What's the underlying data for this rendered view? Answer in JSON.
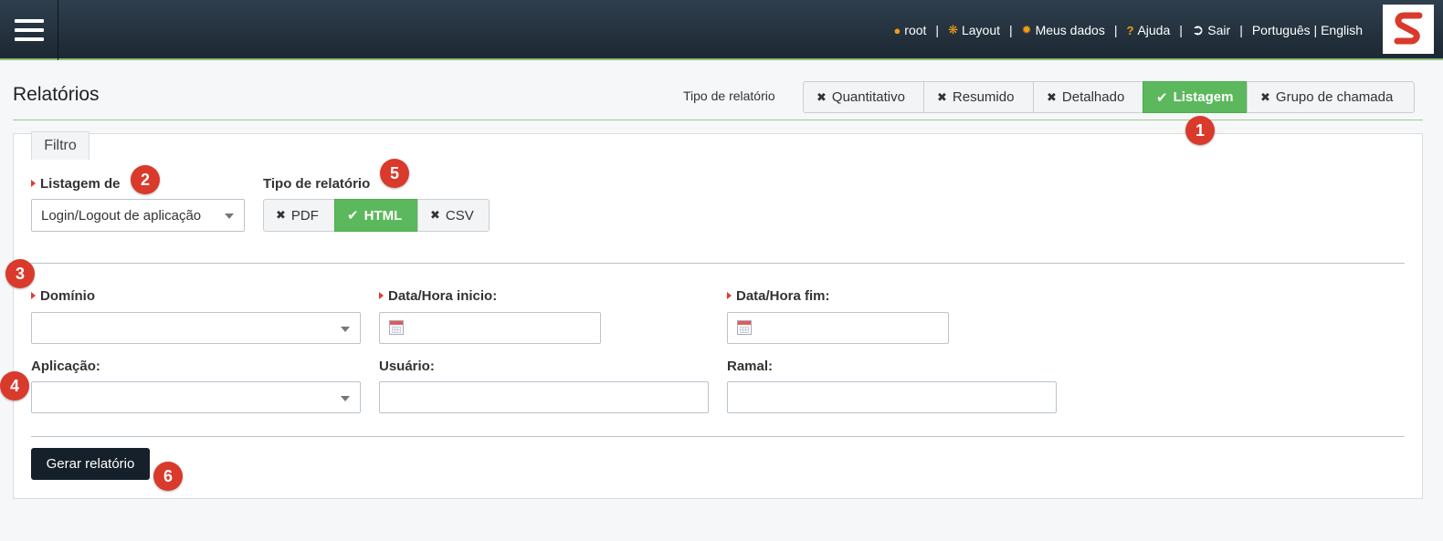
{
  "topbar": {
    "nav": [
      {
        "icon": "user-icon",
        "label": "root"
      },
      {
        "icon": "cogs-icon",
        "label": "Layout"
      },
      {
        "icon": "gear-icon",
        "label": "Meus dados"
      },
      {
        "icon": "help-icon",
        "label": "Ajuda"
      },
      {
        "icon": "sign-out-icon",
        "label": "Sair"
      }
    ],
    "languages": "Português | English",
    "separator": "|"
  },
  "page": {
    "title": "Relatórios",
    "report_type_label": "Tipo de relatório",
    "report_types": [
      {
        "label": "Quantitativo",
        "active": false
      },
      {
        "label": "Resumido",
        "active": false
      },
      {
        "label": "Detalhado",
        "active": false
      },
      {
        "label": "Listagem",
        "active": true
      },
      {
        "label": "Grupo de chamada",
        "active": false
      }
    ]
  },
  "filter": {
    "tab_label": "Filtro",
    "listagem_label": "Listagem de",
    "listagem_value": "Login/Logout de aplicação",
    "format_label": "Tipo de relatório",
    "formats": [
      {
        "label": "PDF",
        "active": false
      },
      {
        "label": "HTML",
        "active": true
      },
      {
        "label": "CSV",
        "active": false
      }
    ],
    "dominio_label": "Domínio",
    "dominio_value": "",
    "inicio_label": "Data/Hora inicio:",
    "fim_label": "Data/Hora fim:",
    "aplicacao_label": "Aplicação:",
    "aplicacao_value": "",
    "usuario_label": "Usuário:",
    "ramal_label": "Ramal:",
    "generate_label": "Gerar relatório"
  },
  "badges": [
    "1",
    "2",
    "3",
    "4",
    "5",
    "6"
  ],
  "colors": {
    "topbar": "#1c2833",
    "active_green": "#5cb85c",
    "badge_red": "#d93a2b",
    "required_marker": "#e53935",
    "generate_button": "#15202b"
  }
}
